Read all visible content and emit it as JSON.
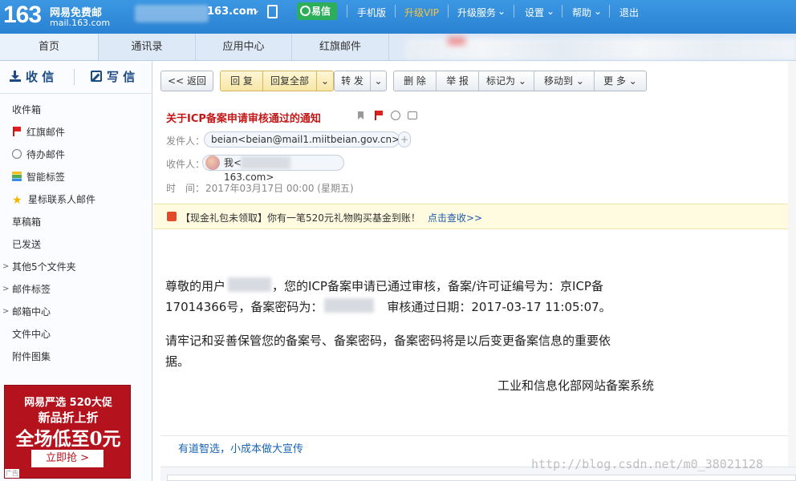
{
  "topbar": {
    "logo_number": "163",
    "logo_title": "网易免费邮",
    "logo_domain": "mail.163.com",
    "account_suffix": "163.com",
    "yixin_label": "易信",
    "nav": [
      "手机版",
      "升级VIP",
      "升级服务",
      "设置",
      "帮助",
      "退出"
    ]
  },
  "nav2": {
    "tabs": [
      "首页",
      "通讯录",
      "应用中心",
      "红旗邮件"
    ]
  },
  "sidebar": {
    "receive_label": "收 信",
    "write_label": "写 信",
    "items": [
      {
        "label": "收件箱",
        "icon": ""
      },
      {
        "label": "红旗邮件",
        "icon": "red-flag-icon"
      },
      {
        "label": "待办邮件",
        "icon": "clock-icon"
      },
      {
        "label": "智能标签",
        "icon": "tag-stripes-icon"
      },
      {
        "label": "星标联系人邮件",
        "icon": "star-icon"
      },
      {
        "label": "草稿箱",
        "icon": ""
      },
      {
        "label": "已发送",
        "icon": ""
      },
      {
        "label": "其他5个文件夹",
        "icon": "chevron-right-icon"
      },
      {
        "label": "邮件标签",
        "icon": "chevron-right-icon"
      },
      {
        "label": "邮箱中心",
        "icon": "chevron-right-icon"
      },
      {
        "label": "文件中心",
        "icon": ""
      },
      {
        "label": "附件图集",
        "icon": ""
      }
    ],
    "ad": {
      "line1": "网易严选 520大促",
      "line2": "新品折上折",
      "line3": "全场低至0元",
      "button": "立即抢 >",
      "tag": "广告"
    }
  },
  "toolbar": {
    "back": "<< 返回",
    "reply": "回 复",
    "reply_all": "回复全部",
    "forward": "转 发",
    "delete": "删 除",
    "report": "举 报",
    "mark_as": "标记为",
    "move_to": "移动到",
    "more": "更 多"
  },
  "mail": {
    "subject": "关于ICP备案申请审核通过的通知",
    "from_label": "发件人：",
    "from": "beian<beian@mail1.miitbeian.gov.cn>",
    "to_label": "收件人：",
    "to_prefix": "我<",
    "to_suffix": "163.com>",
    "time_label": "时　间：",
    "time": "2017年03月17日 00:00 (星期五)"
  },
  "notice": {
    "text": "【现金礼包未领取】你有一笔520元礼物购买基金到账！",
    "link": "点击查收>>"
  },
  "body": {
    "p1a": "尊敬的用户",
    "p1b": "，您的ICP备案申请已通过审核，备案/许可证编号为：京ICP备",
    "p1c": "17014366号，备案密码为：",
    "p1d": "审核通过日期：2017-03-17 11:05:07。",
    "p2a": "请牢记和妥善保管您的备案号、备案密码，备案密码将是以后变更备案信息的重要依",
    "p2b": "据。",
    "signature": "工业和信息化部网站备案系统"
  },
  "footer": {
    "link": "有道智选，小成本做大宣传"
  },
  "watermark": "http://blog.csdn.net/m0_38021128"
}
